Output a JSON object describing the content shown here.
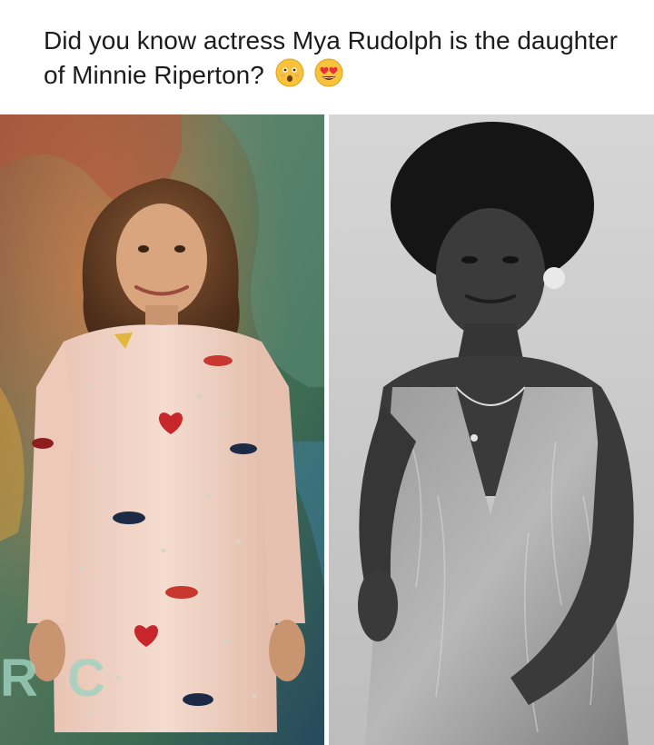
{
  "post": {
    "caption": "Did you know actress Mya Rudolph is the daughter of Minnie Riperton?",
    "emojis": [
      "astonished-face-icon",
      "heart-eyes-face-icon"
    ]
  },
  "photos": {
    "left": {
      "backdrop_letters": "R  C"
    },
    "right": {}
  },
  "colors": {
    "caption_text": "#1c1c1c",
    "dress": "#efd2c4",
    "lip_red": "#c7392e",
    "lip_navy": "#1d2a46",
    "backdrop_green": "#3c6a52"
  }
}
